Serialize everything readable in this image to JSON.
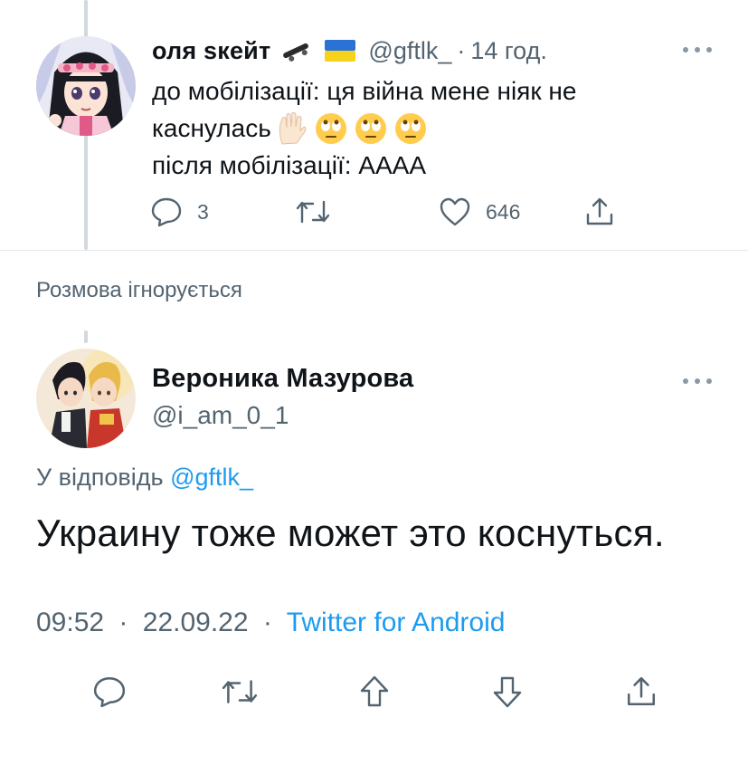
{
  "tweet1": {
    "author_name": "оля sкейт",
    "handle": "@gftlk_",
    "dot": "·",
    "time": "14 год.",
    "text_line1": "до мобілізації: ця війна мене ніяк не",
    "text_line2": "каснулась",
    "text_line3": "після мобілізації: АААА",
    "inline_emoji_icons": [
      "raised-hand-icon",
      "eye-roll-icon",
      "eye-roll-icon",
      "eye-roll-icon"
    ],
    "name_emoji_icons": [
      "skateboard-icon",
      "ukraine-flag-icon"
    ],
    "actions": {
      "reply_count": "3",
      "retweet_count": "",
      "like_count": "646"
    }
  },
  "conversation_status": "Розмова ігнорується",
  "tweet2": {
    "author_name": "Вероника Мазурова",
    "handle": "@i_am_0_1",
    "reply_prefix": "У відповідь",
    "reply_to": "@gftlk_",
    "text": "Украину тоже может это коснуться.",
    "meta_time": "09:52",
    "meta_sep": "·",
    "meta_date": "22.09.22",
    "meta_sep2": "·",
    "meta_source": "Twitter for Android",
    "action_icons": [
      "reply-icon",
      "retweet-icon",
      "upvote-icon",
      "downvote-icon",
      "share-icon"
    ]
  },
  "colors": {
    "text_primary": "#0f1419",
    "text_secondary": "#536471",
    "link": "#1d9bf0",
    "divider": "#e1e8ed",
    "thread_line": "#cfd9de",
    "flag_blue": "#2a73d4",
    "flag_yellow": "#f7d21c"
  }
}
